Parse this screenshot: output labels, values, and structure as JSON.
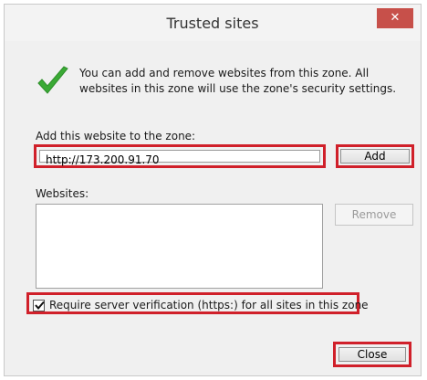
{
  "window": {
    "title": "Trusted sites",
    "close_glyph": "✕"
  },
  "intro": {
    "icon": "green-checkmark-icon",
    "text": "You can add and remove websites from this zone. All websites in this zone will use the zone's security settings."
  },
  "add_section": {
    "label": "Add this website to the zone:",
    "input_value": "http://173.200.91.70",
    "add_button": "Add"
  },
  "websites": {
    "label": "Websites:",
    "items": [],
    "remove_button": "Remove"
  },
  "https_option": {
    "label": "Require server verification (https:) for all sites in this zone",
    "checked": true
  },
  "footer": {
    "close_button": "Close"
  },
  "colors": {
    "highlight": "#d0202a",
    "close_red": "#c7504a",
    "check_green": "#3aaa35"
  }
}
